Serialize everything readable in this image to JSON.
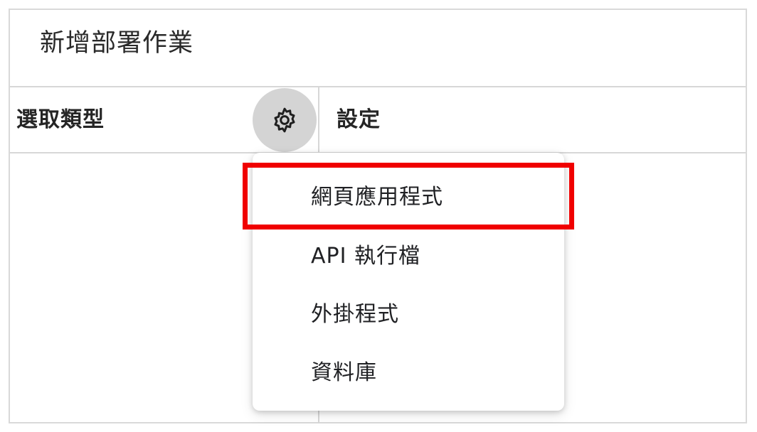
{
  "dialog": {
    "title": "新增部署作業"
  },
  "columns": {
    "left_header": "選取類型",
    "right_header": "設定"
  },
  "icons": {
    "gear": "gear-icon"
  },
  "menu": {
    "items": [
      {
        "label": "網頁應用程式",
        "highlighted": true
      },
      {
        "label": "API 執行檔"
      },
      {
        "label": "外掛程式"
      },
      {
        "label": "資料庫"
      }
    ]
  },
  "colors": {
    "highlight": "#f00000",
    "gear_button_bg": "#d4d4d4",
    "divider": "#d7d7d7"
  }
}
